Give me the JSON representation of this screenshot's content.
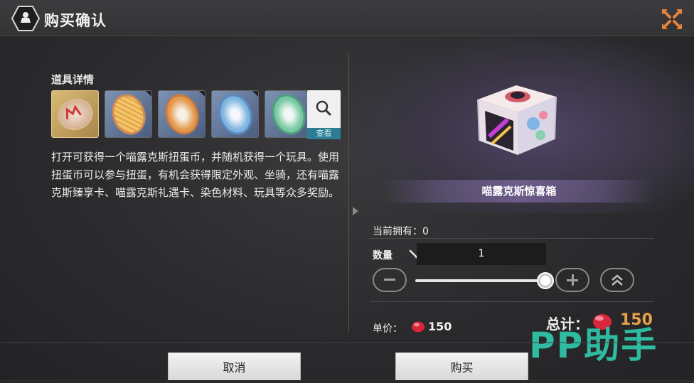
{
  "title": "购买确认",
  "details_label": "道具详情",
  "search_label": "查看",
  "description": "打开可获得一个喵露克斯扭蛋币，并随机获得一个玩具。使用扭蛋币可以参与扭蛋，有机会获得限定外观、坐骑，还有喵露克斯臻享卡、喵露克斯礼遇卡、染色材料、玩具等众多奖励。",
  "item_name": "喵露克斯惊喜箱",
  "owned_label": "当前拥有：",
  "owned_value": "0",
  "quantity_label": "数量",
  "quantity_value": "1",
  "unit_price_label": "单价：",
  "unit_price": "150",
  "total_label": "总计：",
  "total_value": "150",
  "watermark": "PP助手",
  "cancel_label": "取消",
  "buy_label": "购买",
  "thumbnails": [
    {
      "icon": "red-coin-icon",
      "bg": "#c9a55f"
    },
    {
      "icon": "gold-coin-icon",
      "bg": "#5b6f8f"
    },
    {
      "icon": "orange-coin-icon",
      "bg": "#5b6f8f"
    },
    {
      "icon": "blue-coin-icon",
      "bg": "#5b6f8f"
    },
    {
      "icon": "green-coin-icon",
      "bg": "#5b6f8f"
    }
  ],
  "colors": {
    "accent_orange": "#e7a04a",
    "search_tab": "#2a7d93",
    "watermark": "#30c8aa"
  }
}
